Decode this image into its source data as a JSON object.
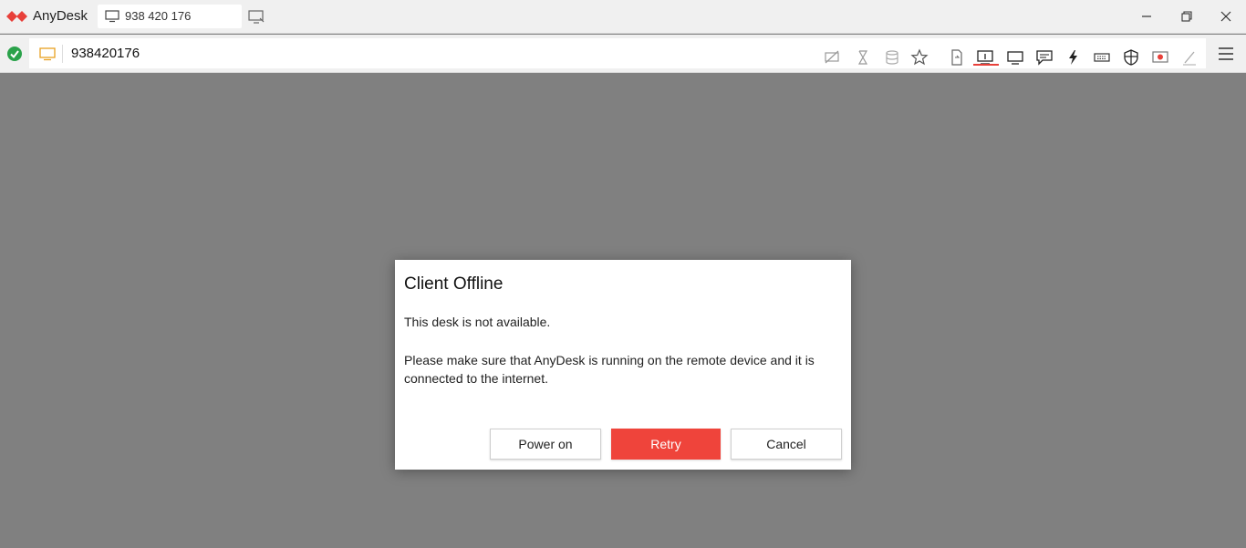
{
  "titlebar": {
    "app_name": "AnyDesk",
    "tab_label": "938 420 176",
    "brand_color": "#e8403a"
  },
  "toolbar": {
    "address_value": "938420176",
    "status": "connected-ok",
    "icons": [
      "privacy-mode-icon",
      "hourglass-icon",
      "database-icon",
      "favorite-star-icon",
      "file-transfer-icon",
      "monitor-1-icon",
      "display-icon",
      "chat-icon",
      "actions-lightning-icon",
      "keyboard-icon",
      "permissions-shield-icon",
      "record-icon",
      "whiteboard-pen-icon",
      "main-menu-icon"
    ]
  },
  "dialog": {
    "title": "Client Offline",
    "message1": "This desk is not available.",
    "message2": "Please make sure that AnyDesk is running on the remote device and it is connected to the internet.",
    "buttons": {
      "power_on": "Power on",
      "retry": "Retry",
      "cancel": "Cancel"
    },
    "retry_color": "#ef443b"
  }
}
